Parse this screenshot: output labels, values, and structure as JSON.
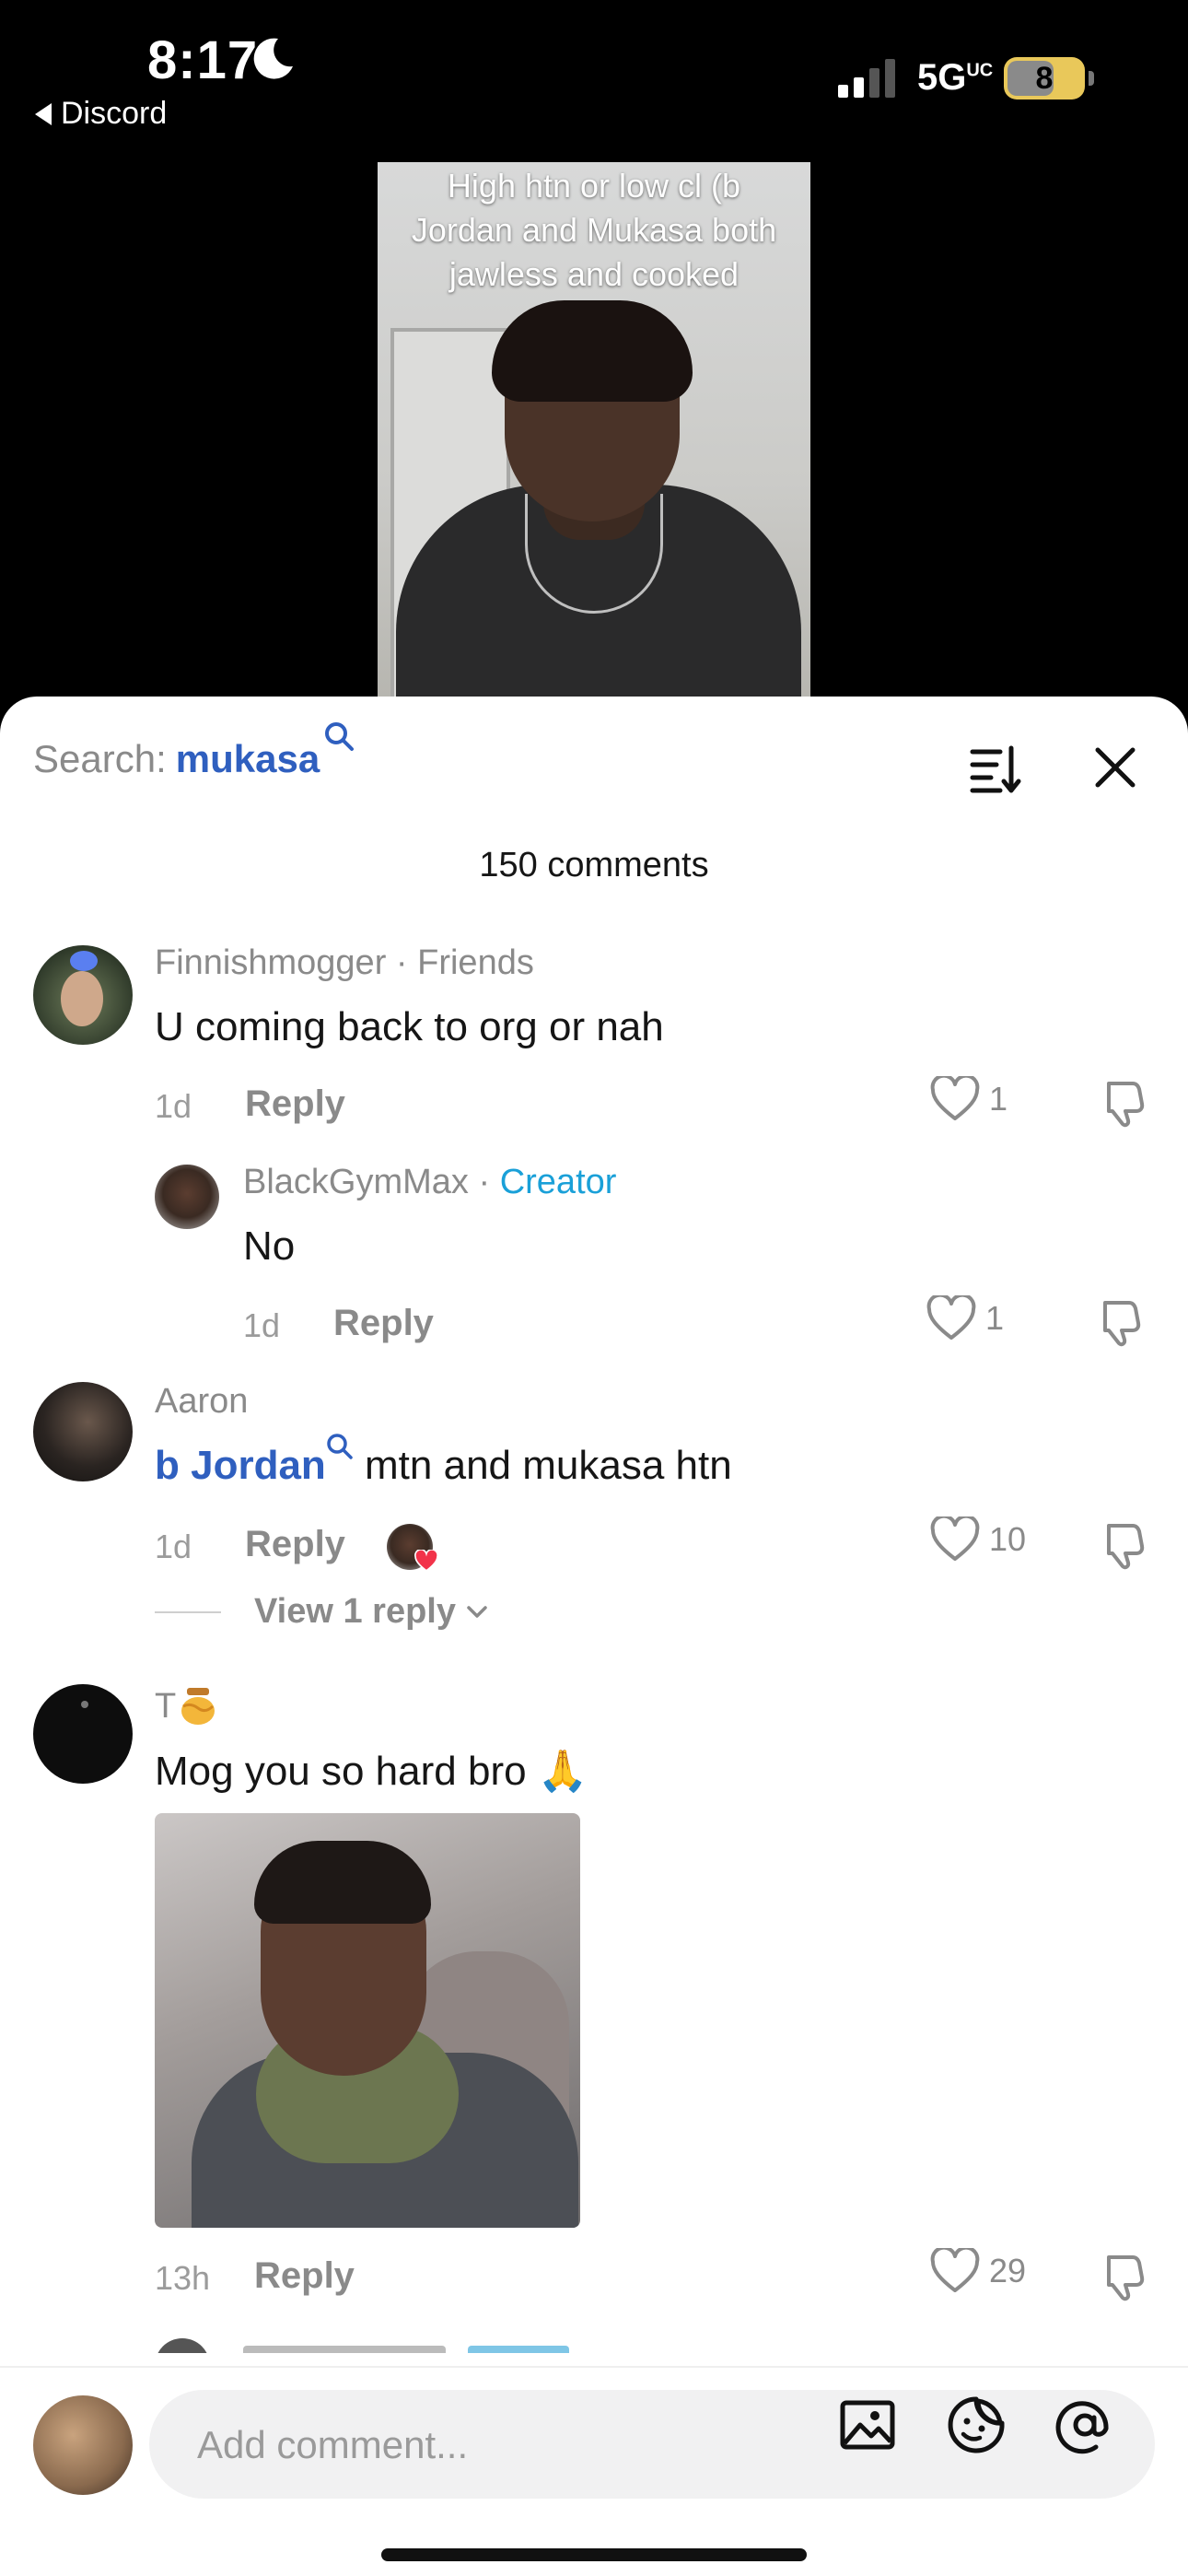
{
  "status_bar": {
    "time": "8:17",
    "back_app": "Discord",
    "network": "5G",
    "network_sup": "UC",
    "battery": "8"
  },
  "video": {
    "caption": "High htn or low cl (b Jordan and Mukasa both jawless and cooked"
  },
  "comments_sheet": {
    "search_label": "Search:",
    "search_term": "mukasa",
    "count_label": "150 comments",
    "comments": [
      {
        "username": "Finnishmogger",
        "tag": "Friends",
        "text": "U coming back to org or nah",
        "time": "1d",
        "reply_label": "Reply",
        "likes": "1"
      },
      {
        "username": "BlackGymMax",
        "tag": "Creator",
        "text": "No",
        "time": "1d",
        "reply_label": "Reply",
        "likes": "1"
      },
      {
        "username": "Aaron",
        "mention": "b Jordan",
        "text": " mtn and mukasa htn",
        "time": "1d",
        "reply_label": "Reply",
        "likes": "10",
        "view_replies": "View 1 reply"
      },
      {
        "username": "T",
        "text": "Mog you so hard bro",
        "emoji": "🙏",
        "time": "13h",
        "reply_label": "Reply",
        "likes": "29"
      }
    ]
  },
  "input_bar": {
    "placeholder": "Add comment..."
  },
  "colors": {
    "mention_blue": "#2f5fbf",
    "creator_blue": "#1aa0d8",
    "battery_yellow": "#e9c85a"
  }
}
